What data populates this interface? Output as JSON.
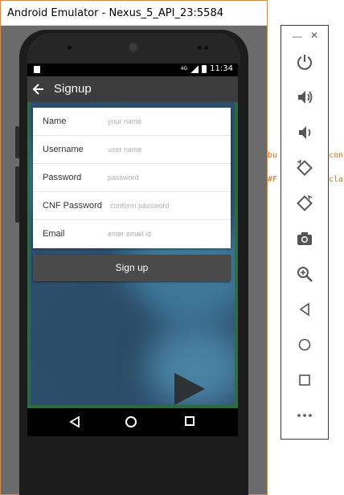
{
  "window": {
    "title": "Android Emulator - Nexus_5_API_23:5584"
  },
  "statusbar": {
    "network": "4G",
    "time": "11:34"
  },
  "toolbar": {
    "title": "Signup"
  },
  "form": {
    "rows": [
      {
        "label": "Name",
        "placeholder": "your name"
      },
      {
        "label": "Username",
        "placeholder": "user name"
      },
      {
        "label": "Password",
        "placeholder": "password"
      },
      {
        "label": "CNF Password",
        "placeholder": "conform password"
      },
      {
        "label": "Email",
        "placeholder": "enter email id"
      }
    ]
  },
  "signup_button": {
    "label": "Sign up"
  },
  "side_panel": {
    "minimize_glyph": "—",
    "close_glyph": "✕",
    "tools": [
      {
        "icon": "power-icon"
      },
      {
        "icon": "volume-up-icon"
      },
      {
        "icon": "volume-down-icon"
      },
      {
        "icon": "rotate-left-icon"
      },
      {
        "icon": "rotate-right-icon"
      },
      {
        "icon": "camera-icon"
      },
      {
        "icon": "zoom-icon"
      },
      {
        "icon": "back-icon"
      },
      {
        "icon": "home-icon"
      },
      {
        "icon": "overview-icon"
      },
      {
        "icon": "more-icon"
      }
    ]
  },
  "background_code": {
    "line1_a": "bu",
    "line1_b": "con",
    "line2_a": "#F",
    "line2_b": "cla"
  },
  "colors": {
    "toolbar": "#3c3c3c",
    "content_bg": "#2c4f6d",
    "accent_orange": "#d08a4f",
    "button": "#4a4a4a"
  }
}
